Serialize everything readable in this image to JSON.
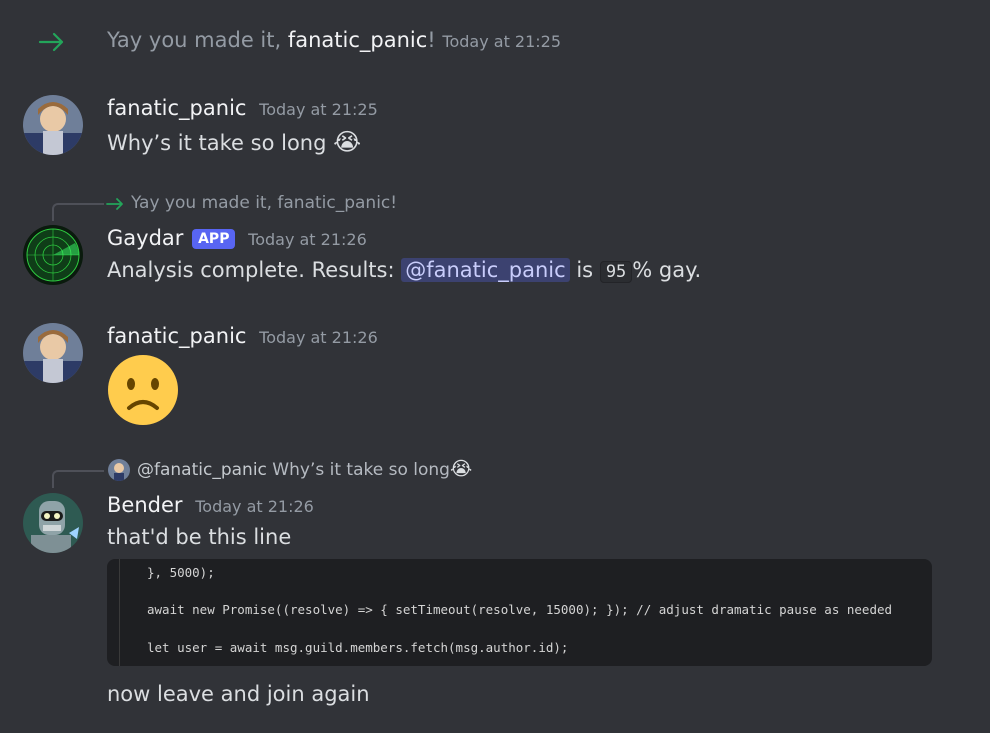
{
  "system_message": {
    "prefix": "Yay you made it, ",
    "user": "fanatic_panic",
    "suffix": "!",
    "timestamp": "Today at 21:25"
  },
  "messages": [
    {
      "author": "fanatic_panic",
      "timestamp": "Today at 21:25",
      "text": "Why’s it take so long",
      "emoji": "😭"
    },
    {
      "reply_to": "Yay you made it, fanatic_panic!",
      "author": "Gaydar",
      "tag": "APP",
      "timestamp": "Today at 21:26",
      "text_before": "Analysis complete. Results: ",
      "mention": "@fanatic_panic",
      "text_mid": " is ",
      "code": "95",
      "text_after": "% gay."
    },
    {
      "author": "fanatic_panic",
      "timestamp": "Today at 21:26",
      "emoji": "☹"
    },
    {
      "reply_mention": "@fanatic_panic",
      "reply_text": "Why’s it take so long",
      "reply_emoji": "😭",
      "author": "Bender",
      "timestamp": "Today at 21:26",
      "text": "that'd be this line",
      "code_lines": [
        "}, 5000);",
        "await new Promise((resolve) => { setTimeout(resolve, 15000); }); // adjust dramatic pause as needed",
        "let user = await msg.guild.members.fetch(msg.author.id);"
      ],
      "followup": "now leave and join again"
    }
  ],
  "icons": {
    "join_arrow": "arrow-right-icon",
    "reply_arrow": "arrow-right-icon"
  },
  "colors": {
    "background": "#313338",
    "accent": "#5865f2",
    "join_green": "#23a55a",
    "mention_bg": "#3c4270"
  }
}
